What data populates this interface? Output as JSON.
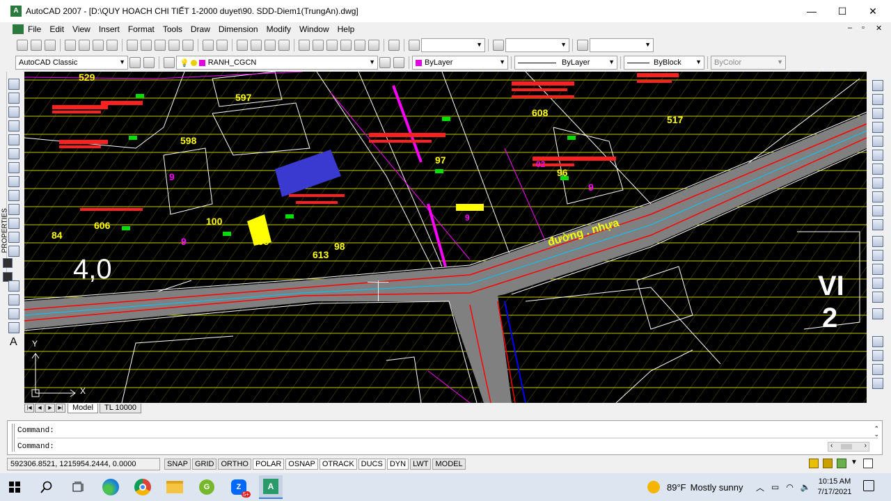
{
  "window": {
    "title": "AutoCAD 2007 - [D:\\QUY HOACH CHI TIẾT 1-2000 duyet\\90. SDD-Diem1(TrungAn).dwg]",
    "minimize_glyph": "—",
    "maximize_glyph": "☐",
    "close_glyph": "✕"
  },
  "menu": [
    "File",
    "Edit",
    "View",
    "Insert",
    "Format",
    "Tools",
    "Draw",
    "Dimension",
    "Modify",
    "Window",
    "Help"
  ],
  "toolbar": {
    "workspace": "AutoCAD Classic",
    "layer": "RANH_CGCN",
    "color": "ByLayer",
    "linetype": "ByLayer",
    "lineweight": "ByBlock",
    "plotstyle": "ByColor"
  },
  "sidebar": {
    "properties_label": "PROPERTIES"
  },
  "drawing": {
    "parcel_labels": [
      "529",
      "597",
      "598",
      "608",
      "517",
      "97",
      "96",
      "100",
      "606",
      "84",
      "605",
      "613",
      "98",
      "9",
      "9",
      "9",
      "9",
      "02"
    ],
    "road_label": "đường . nhựa",
    "big_number": "4,0",
    "zone_label_1": "VI",
    "zone_label_2": "2",
    "ucs_x": "X",
    "ucs_y": "Y",
    "accent_colors": {
      "parcel": "#ffff00",
      "text_red": "#ff2020",
      "road": "#808080",
      "road_edge": "#ff0000",
      "magenta": "#ff00ff",
      "blue_block": "#3a3ad0"
    }
  },
  "tabs": {
    "model": "Model",
    "layout1": "TL 10000"
  },
  "command": {
    "line1": "Command:",
    "line2": "Command:"
  },
  "status": {
    "coords": "592306.8521, 1215954.2444, 0.0000",
    "buttons": [
      "SNAP",
      "GRID",
      "ORTHO",
      "POLAR",
      "OSNAP",
      "OTRACK",
      "DUCS",
      "DYN",
      "LWT",
      "MODEL"
    ]
  },
  "taskbar": {
    "weather_temp": "89°F",
    "weather_desc": "Mostly sunny",
    "time": "10:15 AM",
    "date": "7/17/2021",
    "badge": "5+"
  }
}
